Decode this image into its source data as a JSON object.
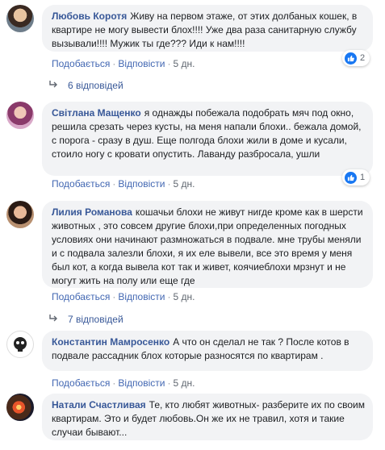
{
  "colors": {
    "link": "#385898",
    "bubble": "#f2f3f5",
    "like": "#1877f2",
    "muted": "#606770"
  },
  "comments": [
    {
      "author": "Любовь Коротя",
      "text": "Живу на первом этаже, от этих долбаных кошек, в квартире не могу вывести блох!!!! Уже два раза санитарную службу вызывали!!!! Мужик ты где??? Иди к нам!!!!",
      "like": "Подобається",
      "reply": "Відповісти",
      "time": "5 дн.",
      "reactions": "2",
      "replies": "6 відповідей"
    },
    {
      "author": "Світлана Мащенко",
      "text": "я однажды побежала подобрать мяч под окно, решила срезать через кусты, на меня напали блохи.. бежала домой, с порога - сразу в душ. Еще полгода блохи жили в доме и кусали, стоило ногу с кровати опустить. Лаванду разбросала, ушли",
      "like": "Подобається",
      "reply": "Відповісти",
      "time": "5 дн.",
      "reactions": "1"
    },
    {
      "author": "Лилия Романова",
      "text": "кошачьи блохи не живут нигде кроме как в шерсти животных , это совсем другие блохи,при определенных погодных условиях они начинают размножаться в подвале. мне трубы меняли и с подвала залезли блохи, я их еле вывели, все это время у меня был кот, а когда вывела кот так и живет, коячиеблохи мрзнут и не могут жить на полу или еще где",
      "like": "Подобається",
      "reply": "Відповісти",
      "time": "5 дн.",
      "replies": "7 відповідей"
    },
    {
      "author": "Константин Мамросенко",
      "text": "А что он сделал не так ? После котов в подвале рассадник блох которые разносятся по квартирам .",
      "like": "Подобається",
      "reply": "Відповісти",
      "time": "5 дн."
    },
    {
      "author": "Натали Счастливая",
      "text": "Те, кто любят животных- разберите их по своим квартирам. Это и будет любовь.Он же их не травил, хотя и такие случаи бывают..."
    }
  ]
}
